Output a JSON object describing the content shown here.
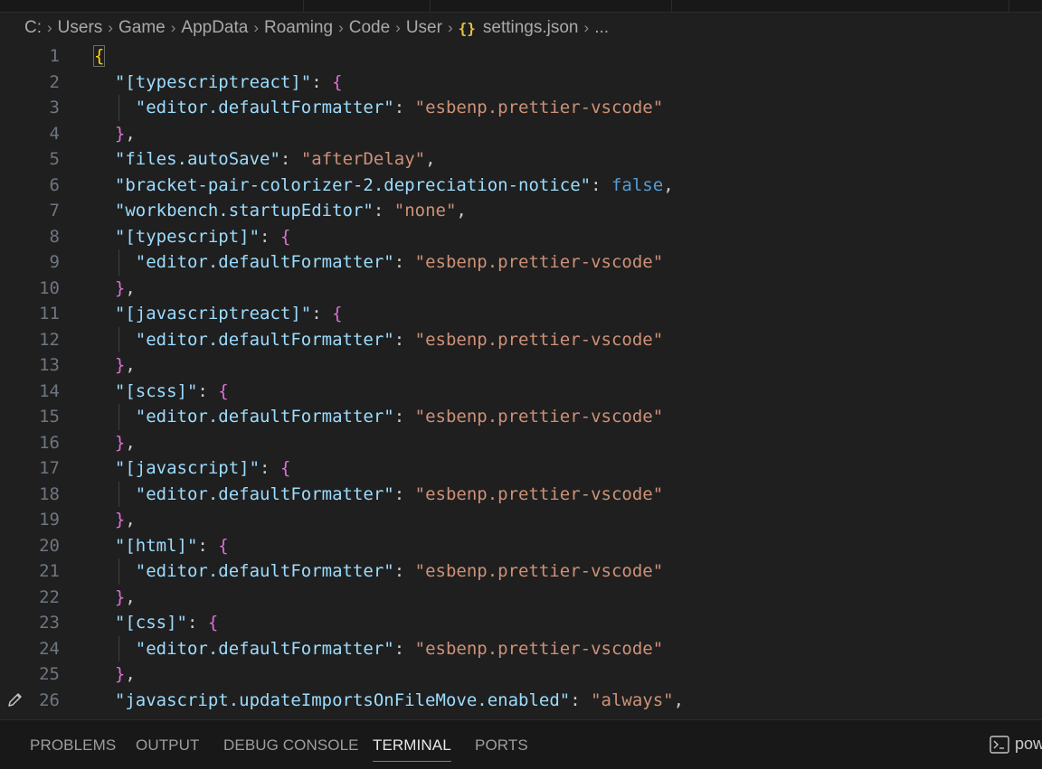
{
  "breadcrumb": {
    "items": [
      "C:",
      "Users",
      "Game",
      "AppData",
      "Roaming",
      "Code",
      "User"
    ],
    "file": "settings.json",
    "file_icon": "{}",
    "ellipsis": "..."
  },
  "editor": {
    "lines": [
      {
        "n": "1",
        "t": "brace-open"
      },
      {
        "n": "2",
        "k": "\"[typescriptreact]\"",
        "open": true
      },
      {
        "n": "3",
        "k": "\"editor.defaultFormatter\"",
        "v": "\"esbenp.prettier-vscode\"",
        "nested": true
      },
      {
        "n": "4",
        "close": true
      },
      {
        "n": "5",
        "k": "\"files.autoSave\"",
        "v": "\"afterDelay\"",
        "comma": true
      },
      {
        "n": "6",
        "k": "\"bracket-pair-colorizer-2.depreciation-notice\"",
        "bool": "false",
        "comma": true
      },
      {
        "n": "7",
        "k": "\"workbench.startupEditor\"",
        "v": "\"none\"",
        "comma": true
      },
      {
        "n": "8",
        "k": "\"[typescript]\"",
        "open": true
      },
      {
        "n": "9",
        "k": "\"editor.defaultFormatter\"",
        "v": "\"esbenp.prettier-vscode\"",
        "nested": true
      },
      {
        "n": "10",
        "close": true
      },
      {
        "n": "11",
        "k": "\"[javascriptreact]\"",
        "open": true
      },
      {
        "n": "12",
        "k": "\"editor.defaultFormatter\"",
        "v": "\"esbenp.prettier-vscode\"",
        "nested": true
      },
      {
        "n": "13",
        "close": true
      },
      {
        "n": "14",
        "k": "\"[scss]\"",
        "open": true
      },
      {
        "n": "15",
        "k": "\"editor.defaultFormatter\"",
        "v": "\"esbenp.prettier-vscode\"",
        "nested": true
      },
      {
        "n": "16",
        "close": true
      },
      {
        "n": "17",
        "k": "\"[javascript]\"",
        "open": true
      },
      {
        "n": "18",
        "k": "\"editor.defaultFormatter\"",
        "v": "\"esbenp.prettier-vscode\"",
        "nested": true
      },
      {
        "n": "19",
        "close": true
      },
      {
        "n": "20",
        "k": "\"[html]\"",
        "open": true
      },
      {
        "n": "21",
        "k": "\"editor.defaultFormatter\"",
        "v": "\"esbenp.prettier-vscode\"",
        "nested": true
      },
      {
        "n": "22",
        "close": true
      },
      {
        "n": "23",
        "k": "\"[css]\"",
        "open": true
      },
      {
        "n": "24",
        "k": "\"editor.defaultFormatter\"",
        "v": "\"esbenp.prettier-vscode\"",
        "nested": true
      },
      {
        "n": "25",
        "close": true
      },
      {
        "n": "26",
        "k": "\"javascript.updateImportsOnFileMove.enabled\"",
        "v": "\"always\"",
        "comma": true
      }
    ]
  },
  "panel": {
    "tabs": [
      "PROBLEMS",
      "OUTPUT",
      "DEBUG CONSOLE",
      "TERMINAL",
      "PORTS"
    ],
    "active_tab": "TERMINAL",
    "terminal_label": "pow"
  },
  "colors": {
    "key": "#9cdcfe",
    "string": "#ce9178",
    "boolean": "#569cd6",
    "bracket_level1": "#ffd700",
    "bracket_level2": "#da70d6",
    "active_tab_underline": "#3c8ce7"
  }
}
